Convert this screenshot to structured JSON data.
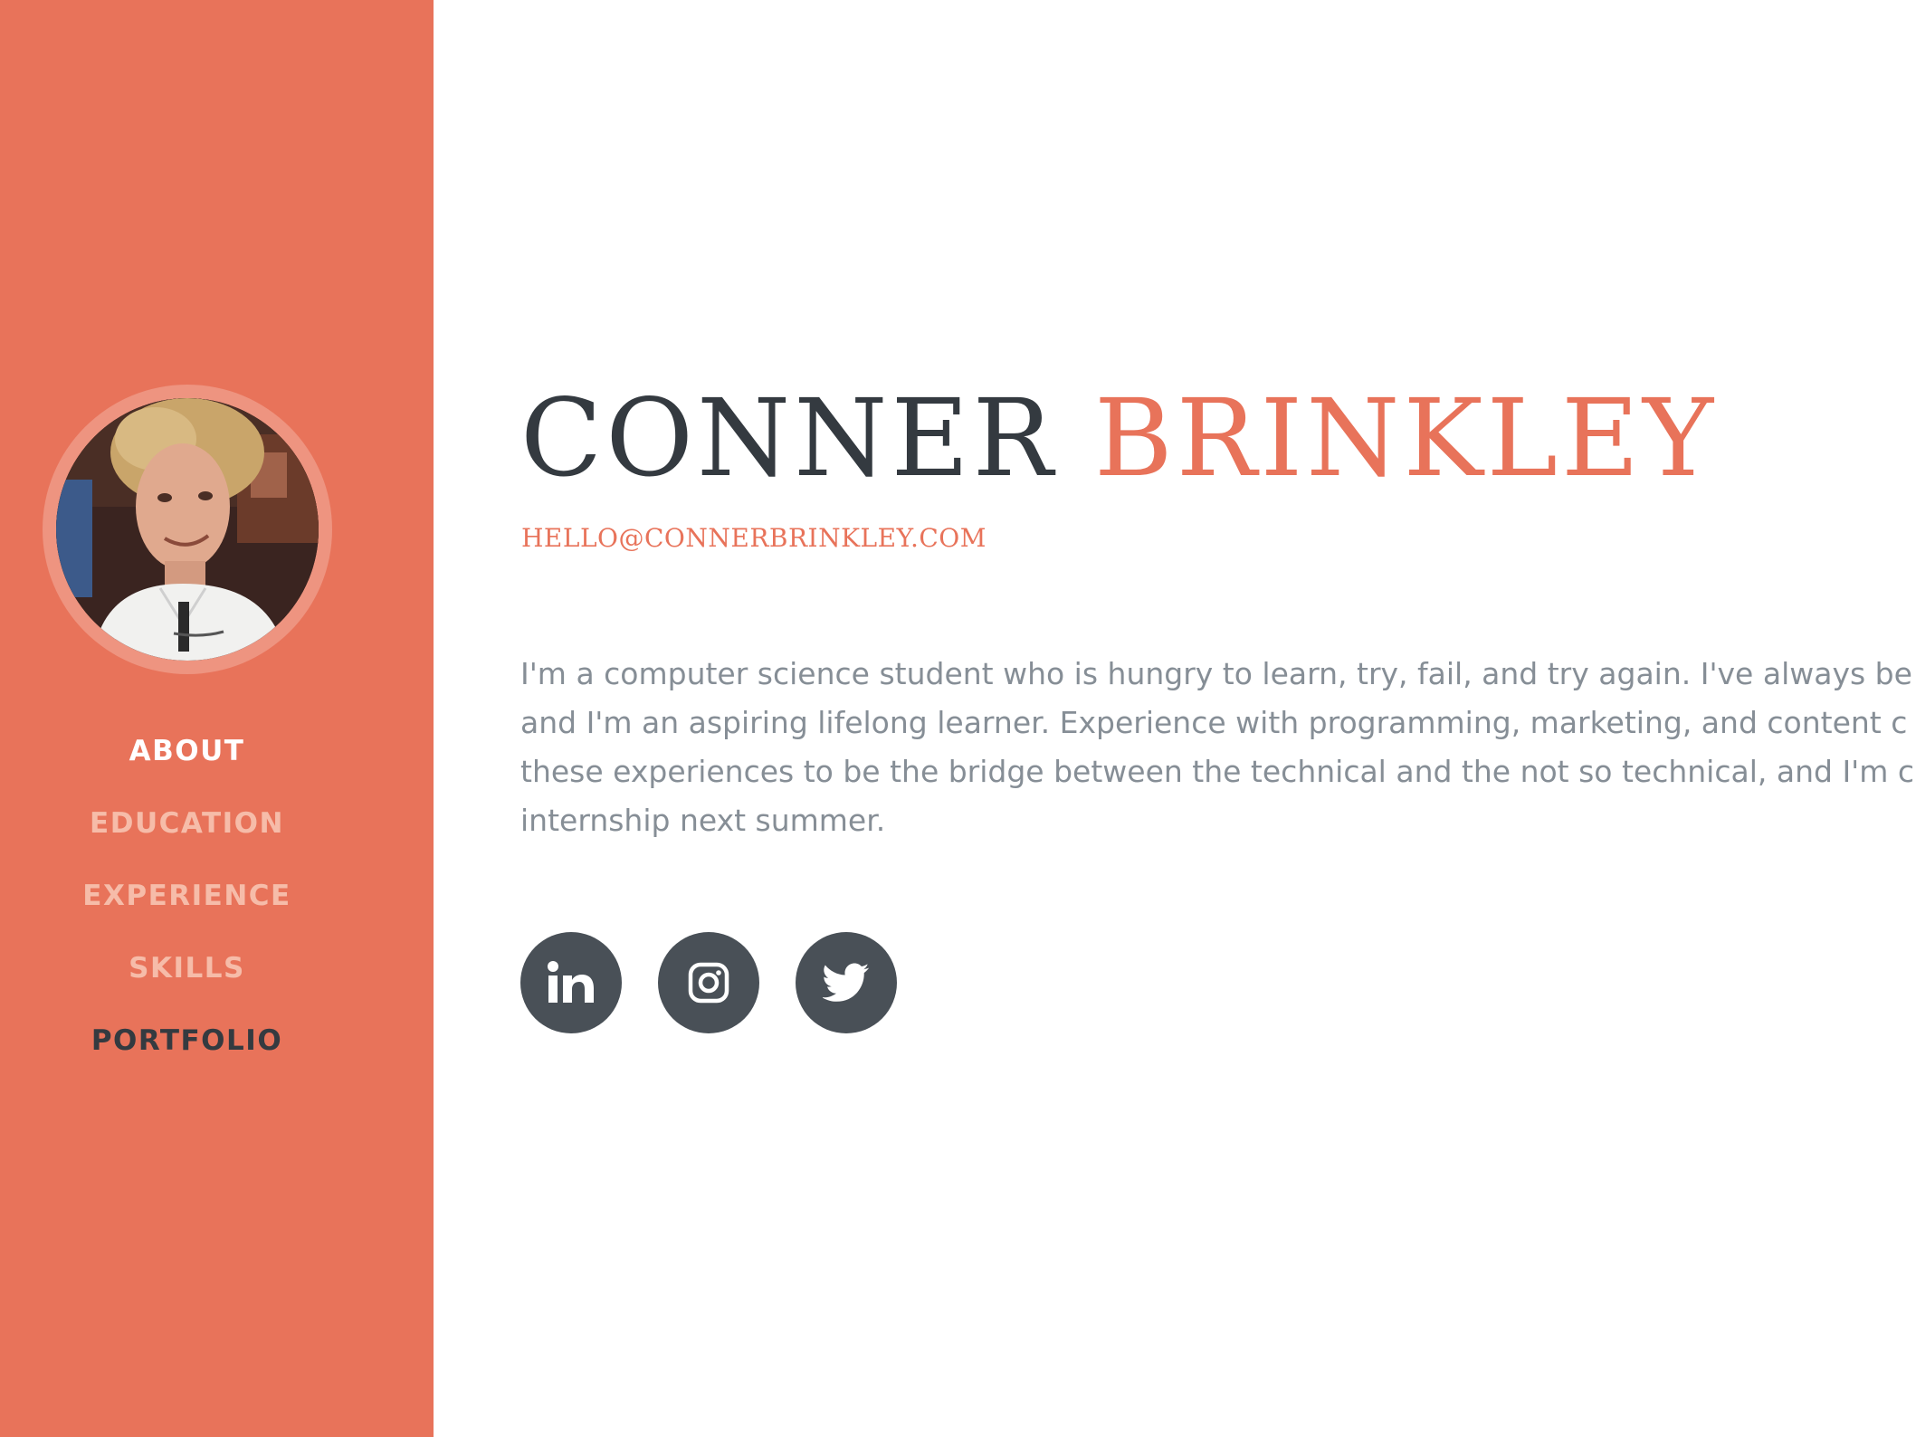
{
  "profile": {
    "first_name": "CONNER",
    "last_name": "BRINKLEY",
    "email": "HELLO@CONNERBRINKLEY.COM",
    "bio_lines": [
      "I'm a computer science student who is hungry to learn, try, fail, and try again. I've always be",
      "and I'm an aspiring lifelong learner. Experience with programming, marketing, and content c",
      "these experiences to be the bridge between the technical and the not so technical, and I'm c",
      "internship next summer."
    ]
  },
  "nav": {
    "items": [
      {
        "label": "ABOUT"
      },
      {
        "label": "EDUCATION"
      },
      {
        "label": "EXPERIENCE"
      },
      {
        "label": "SKILLS"
      },
      {
        "label": "PORTFOLIO"
      }
    ]
  },
  "socials": [
    {
      "icon": "linkedin-icon"
    },
    {
      "icon": "instagram-icon"
    },
    {
      "icon": "twitter-icon"
    }
  ],
  "colors": {
    "accent": "#e8735a",
    "dark": "#343a40",
    "muted_text": "#868e96",
    "social_bg": "#495057"
  }
}
